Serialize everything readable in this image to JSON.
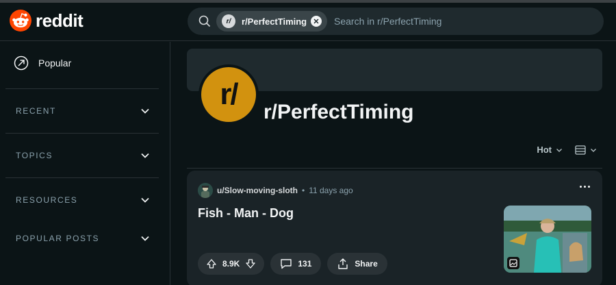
{
  "header": {
    "logo_text": "reddit",
    "search": {
      "chip_avatar": "r/",
      "chip_label": "r/PerfectTiming",
      "placeholder": "Search in r/PerfectTiming"
    }
  },
  "sidebar": {
    "popular_label": "Popular",
    "sections": [
      {
        "label": "RECENT"
      },
      {
        "label": "TOPICS"
      },
      {
        "label": "RESOURCES"
      },
      {
        "label": "POPULAR POSTS"
      }
    ]
  },
  "community": {
    "avatar_text": "r/",
    "name": "r/PerfectTiming",
    "sort_label": "Hot"
  },
  "post": {
    "author": "u/Slow-moving-sloth",
    "separator": "•",
    "time": "11 days ago",
    "title": "Fish - Man - Dog",
    "votes": "8.9K",
    "comments": "131",
    "share_label": "Share"
  },
  "colors": {
    "background": "#0b1416",
    "brand": "#ff4500",
    "community_avatar": "#d2920f"
  }
}
